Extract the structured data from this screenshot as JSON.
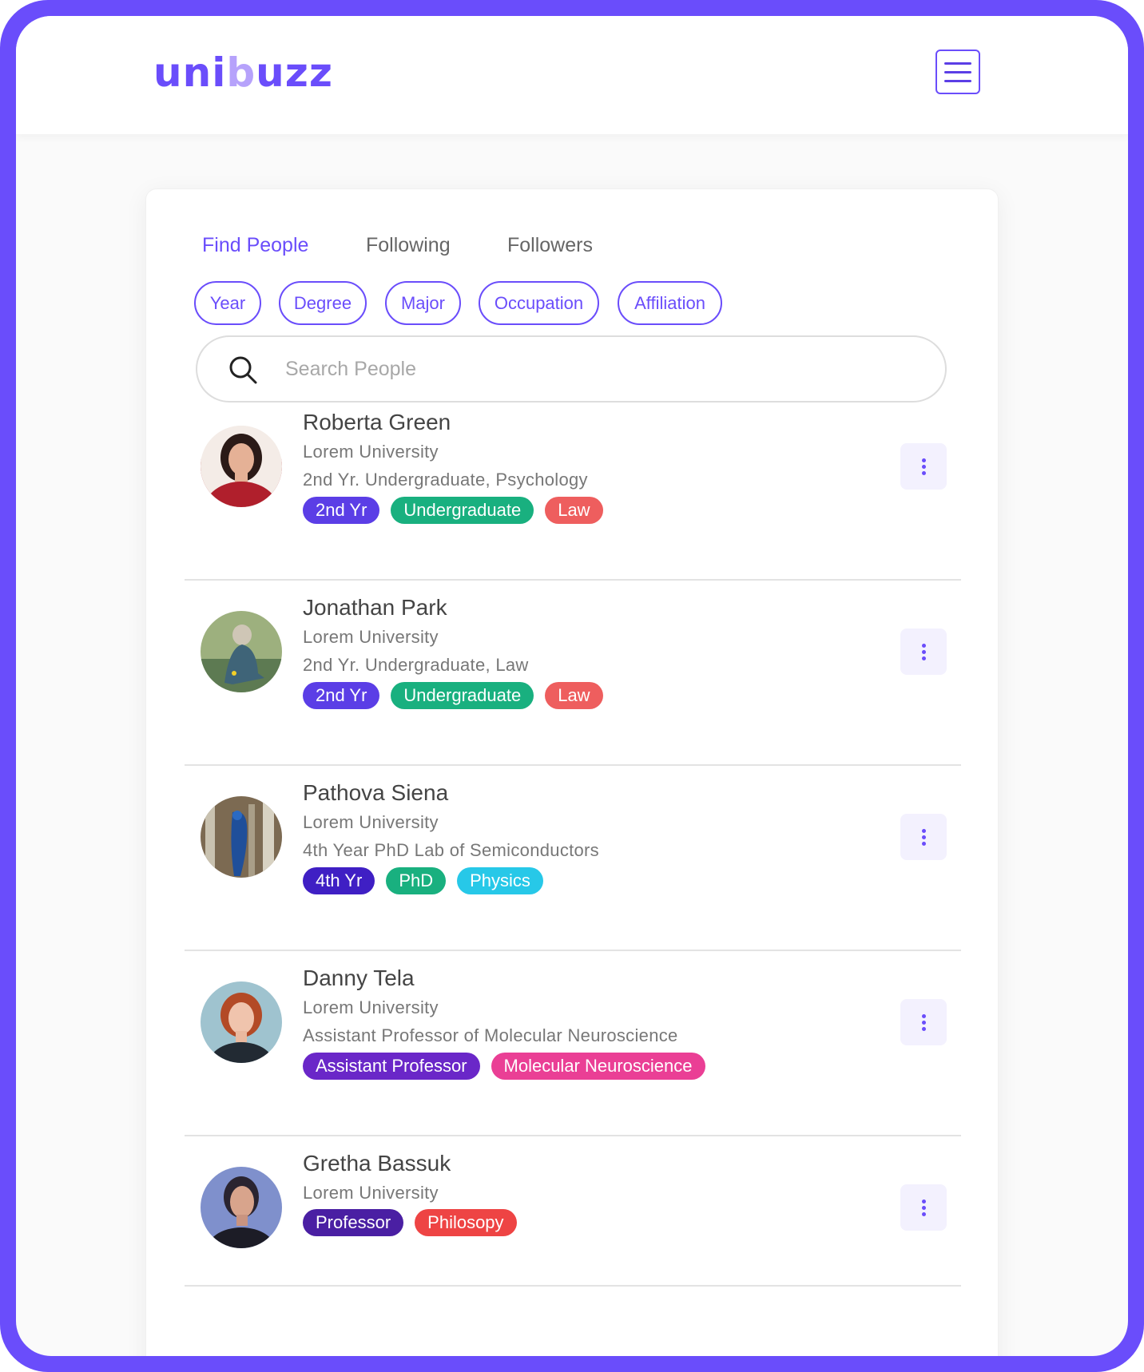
{
  "app": {
    "logo_prefix": "uni",
    "logo_mid": "b",
    "logo_suffix": "uzz"
  },
  "colors": {
    "accent": "#6a4dfb",
    "accent_light": "#b6a2fb",
    "divider": "#e3e3e3"
  },
  "tabs": [
    {
      "label": "Find People",
      "active": true
    },
    {
      "label": "Following",
      "active": false
    },
    {
      "label": "Followers",
      "active": false
    }
  ],
  "filters": [
    "Year",
    "Degree",
    "Major",
    "Occupation",
    "Affiliation"
  ],
  "search": {
    "placeholder": "Search People",
    "icon": "search-icon"
  },
  "people": [
    {
      "name": "Roberta Green",
      "university": "Lorem University",
      "detail": "2nd Yr. Undergraduate, Psychology",
      "tags": [
        {
          "label": "2nd Yr",
          "color": "#5b3ee6"
        },
        {
          "label": "Undergraduate",
          "color": "#19b07f"
        },
        {
          "label": "Law",
          "color": "#ee5e5e"
        }
      ]
    },
    {
      "name": "Jonathan Park",
      "university": "Lorem University",
      "detail": "2nd Yr. Undergraduate, Law",
      "tags": [
        {
          "label": "2nd Yr",
          "color": "#5b3ee6"
        },
        {
          "label": "Undergraduate",
          "color": "#19b07f"
        },
        {
          "label": "Law",
          "color": "#ee5e5e"
        }
      ]
    },
    {
      "name": "Pathova Siena",
      "university": "Lorem University",
      "detail": "4th Year PhD Lab of Semiconductors",
      "tags": [
        {
          "label": "4th Yr",
          "color": "#3f1fc4"
        },
        {
          "label": "PhD",
          "color": "#19b07f"
        },
        {
          "label": "Physics",
          "color": "#27c8e8"
        }
      ]
    },
    {
      "name": "Danny Tela",
      "university": "Lorem University",
      "detail": "Assistant Professor of Molecular Neuroscience",
      "tags": [
        {
          "label": "Assistant Professor",
          "color": "#6a27c8"
        },
        {
          "label": "Molecular Neuroscience",
          "color": "#ea3f95"
        }
      ]
    },
    {
      "name": "Gretha Bassuk",
      "university": "Lorem University",
      "detail": "",
      "tags": [
        {
          "label": "Professor",
          "color": "#4a1fa3"
        },
        {
          "label": "Philosopy",
          "color": "#ee4444"
        }
      ]
    }
  ]
}
